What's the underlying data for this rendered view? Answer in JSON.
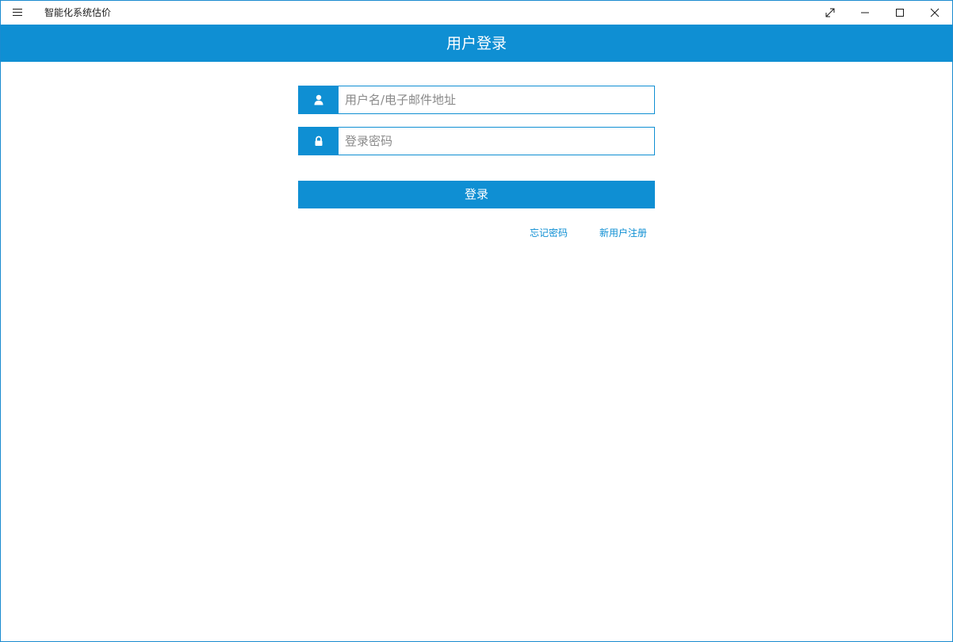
{
  "window": {
    "app_title": "智能化系统估价",
    "controls": {
      "menu_icon": "hamburger-icon",
      "fullscreen_icon": "expand-icon",
      "minimize_icon": "minimize-icon",
      "maximize_icon": "maximize-icon",
      "close_icon": "close-icon"
    }
  },
  "header": {
    "title": "用户登录"
  },
  "login_form": {
    "username": {
      "icon": "user-icon",
      "value": "",
      "placeholder": "用户名/电子邮件地址"
    },
    "password": {
      "icon": "lock-icon",
      "value": "",
      "placeholder": "登录密码"
    },
    "submit_label": "登录",
    "forgot_password_label": "忘记密码",
    "register_label": "新用户注册"
  },
  "colors": {
    "accent": "#0f8fd3",
    "text_dark": "#1a1a1a",
    "placeholder": "#8a8a8a",
    "background": "#ffffff"
  }
}
